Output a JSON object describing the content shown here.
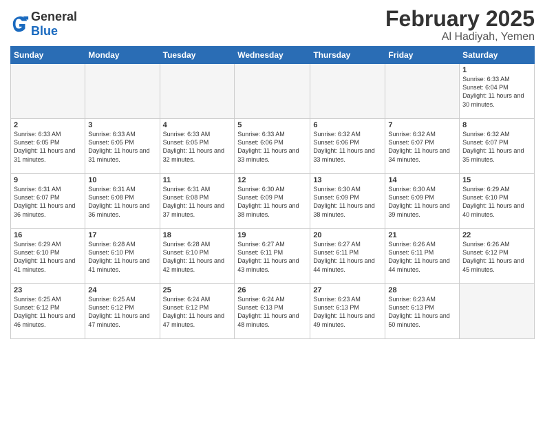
{
  "header": {
    "logo_general": "General",
    "logo_blue": "Blue",
    "title": "February 2025",
    "subtitle": "Al Hadiyah, Yemen"
  },
  "weekdays": [
    "Sunday",
    "Monday",
    "Tuesday",
    "Wednesday",
    "Thursday",
    "Friday",
    "Saturday"
  ],
  "weeks": [
    [
      {
        "day": "",
        "info": ""
      },
      {
        "day": "",
        "info": ""
      },
      {
        "day": "",
        "info": ""
      },
      {
        "day": "",
        "info": ""
      },
      {
        "day": "",
        "info": ""
      },
      {
        "day": "",
        "info": ""
      },
      {
        "day": "1",
        "info": "Sunrise: 6:33 AM\nSunset: 6:04 PM\nDaylight: 11 hours\nand 30 minutes."
      }
    ],
    [
      {
        "day": "2",
        "info": "Sunrise: 6:33 AM\nSunset: 6:05 PM\nDaylight: 11 hours\nand 31 minutes."
      },
      {
        "day": "3",
        "info": "Sunrise: 6:33 AM\nSunset: 6:05 PM\nDaylight: 11 hours\nand 31 minutes."
      },
      {
        "day": "4",
        "info": "Sunrise: 6:33 AM\nSunset: 6:05 PM\nDaylight: 11 hours\nand 32 minutes."
      },
      {
        "day": "5",
        "info": "Sunrise: 6:33 AM\nSunset: 6:06 PM\nDaylight: 11 hours\nand 33 minutes."
      },
      {
        "day": "6",
        "info": "Sunrise: 6:32 AM\nSunset: 6:06 PM\nDaylight: 11 hours\nand 33 minutes."
      },
      {
        "day": "7",
        "info": "Sunrise: 6:32 AM\nSunset: 6:07 PM\nDaylight: 11 hours\nand 34 minutes."
      },
      {
        "day": "8",
        "info": "Sunrise: 6:32 AM\nSunset: 6:07 PM\nDaylight: 11 hours\nand 35 minutes."
      }
    ],
    [
      {
        "day": "9",
        "info": "Sunrise: 6:31 AM\nSunset: 6:07 PM\nDaylight: 11 hours\nand 36 minutes."
      },
      {
        "day": "10",
        "info": "Sunrise: 6:31 AM\nSunset: 6:08 PM\nDaylight: 11 hours\nand 36 minutes."
      },
      {
        "day": "11",
        "info": "Sunrise: 6:31 AM\nSunset: 6:08 PM\nDaylight: 11 hours\nand 37 minutes."
      },
      {
        "day": "12",
        "info": "Sunrise: 6:30 AM\nSunset: 6:09 PM\nDaylight: 11 hours\nand 38 minutes."
      },
      {
        "day": "13",
        "info": "Sunrise: 6:30 AM\nSunset: 6:09 PM\nDaylight: 11 hours\nand 38 minutes."
      },
      {
        "day": "14",
        "info": "Sunrise: 6:30 AM\nSunset: 6:09 PM\nDaylight: 11 hours\nand 39 minutes."
      },
      {
        "day": "15",
        "info": "Sunrise: 6:29 AM\nSunset: 6:10 PM\nDaylight: 11 hours\nand 40 minutes."
      }
    ],
    [
      {
        "day": "16",
        "info": "Sunrise: 6:29 AM\nSunset: 6:10 PM\nDaylight: 11 hours\nand 41 minutes."
      },
      {
        "day": "17",
        "info": "Sunrise: 6:28 AM\nSunset: 6:10 PM\nDaylight: 11 hours\nand 41 minutes."
      },
      {
        "day": "18",
        "info": "Sunrise: 6:28 AM\nSunset: 6:10 PM\nDaylight: 11 hours\nand 42 minutes."
      },
      {
        "day": "19",
        "info": "Sunrise: 6:27 AM\nSunset: 6:11 PM\nDaylight: 11 hours\nand 43 minutes."
      },
      {
        "day": "20",
        "info": "Sunrise: 6:27 AM\nSunset: 6:11 PM\nDaylight: 11 hours\nand 44 minutes."
      },
      {
        "day": "21",
        "info": "Sunrise: 6:26 AM\nSunset: 6:11 PM\nDaylight: 11 hours\nand 44 minutes."
      },
      {
        "day": "22",
        "info": "Sunrise: 6:26 AM\nSunset: 6:12 PM\nDaylight: 11 hours\nand 45 minutes."
      }
    ],
    [
      {
        "day": "23",
        "info": "Sunrise: 6:25 AM\nSunset: 6:12 PM\nDaylight: 11 hours\nand 46 minutes."
      },
      {
        "day": "24",
        "info": "Sunrise: 6:25 AM\nSunset: 6:12 PM\nDaylight: 11 hours\nand 47 minutes."
      },
      {
        "day": "25",
        "info": "Sunrise: 6:24 AM\nSunset: 6:12 PM\nDaylight: 11 hours\nand 47 minutes."
      },
      {
        "day": "26",
        "info": "Sunrise: 6:24 AM\nSunset: 6:13 PM\nDaylight: 11 hours\nand 48 minutes."
      },
      {
        "day": "27",
        "info": "Sunrise: 6:23 AM\nSunset: 6:13 PM\nDaylight: 11 hours\nand 49 minutes."
      },
      {
        "day": "28",
        "info": "Sunrise: 6:23 AM\nSunset: 6:13 PM\nDaylight: 11 hours\nand 50 minutes."
      },
      {
        "day": "",
        "info": ""
      }
    ]
  ]
}
